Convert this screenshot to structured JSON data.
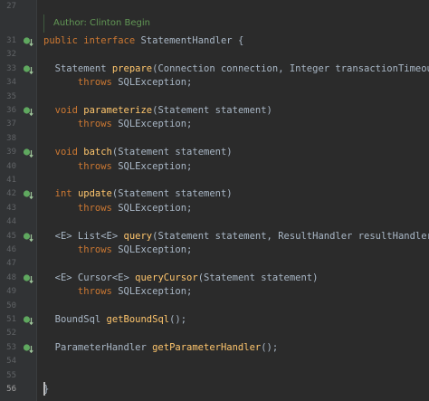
{
  "editor": {
    "javadoc": {
      "author": "Author: Clinton Begin"
    },
    "lines": [
      {
        "num": "27",
        "tokens": []
      },
      {
        "num": "31",
        "icon": true,
        "tokens": [
          {
            "t": "public ",
            "c": "kw"
          },
          {
            "t": "interface ",
            "c": "kw"
          },
          {
            "t": "StatementHandler {",
            "c": "plain"
          }
        ]
      },
      {
        "num": "32",
        "tokens": []
      },
      {
        "num": "33",
        "icon": true,
        "tokens": [
          {
            "t": "  Statement ",
            "c": "plain"
          },
          {
            "t": "prepare",
            "c": "fn"
          },
          {
            "t": "(Connection connection, Integer transactionTimeout)",
            "c": "plain"
          }
        ]
      },
      {
        "num": "34",
        "tokens": [
          {
            "t": "      throws ",
            "c": "kw"
          },
          {
            "t": "SQLException;",
            "c": "plain"
          }
        ]
      },
      {
        "num": "35",
        "tokens": []
      },
      {
        "num": "36",
        "icon": true,
        "tokens": [
          {
            "t": "  void ",
            "c": "kw"
          },
          {
            "t": "parameterize",
            "c": "fn"
          },
          {
            "t": "(Statement statement)",
            "c": "plain"
          }
        ]
      },
      {
        "num": "37",
        "tokens": [
          {
            "t": "      throws ",
            "c": "kw"
          },
          {
            "t": "SQLException;",
            "c": "plain"
          }
        ]
      },
      {
        "num": "38",
        "tokens": []
      },
      {
        "num": "39",
        "icon": true,
        "tokens": [
          {
            "t": "  void ",
            "c": "kw"
          },
          {
            "t": "batch",
            "c": "fn"
          },
          {
            "t": "(Statement statement)",
            "c": "plain"
          }
        ]
      },
      {
        "num": "40",
        "tokens": [
          {
            "t": "      throws ",
            "c": "kw"
          },
          {
            "t": "SQLException;",
            "c": "plain"
          }
        ]
      },
      {
        "num": "41",
        "tokens": []
      },
      {
        "num": "42",
        "icon": true,
        "tokens": [
          {
            "t": "  int ",
            "c": "kw"
          },
          {
            "t": "update",
            "c": "fn"
          },
          {
            "t": "(Statement statement)",
            "c": "plain"
          }
        ]
      },
      {
        "num": "43",
        "tokens": [
          {
            "t": "      throws ",
            "c": "kw"
          },
          {
            "t": "SQLException;",
            "c": "plain"
          }
        ]
      },
      {
        "num": "44",
        "tokens": []
      },
      {
        "num": "45",
        "icon": true,
        "tokens": [
          {
            "t": "  <E> List<E> ",
            "c": "plain"
          },
          {
            "t": "query",
            "c": "fn"
          },
          {
            "t": "(Statement statement, ResultHandler resultHandler)",
            "c": "plain"
          }
        ]
      },
      {
        "num": "46",
        "tokens": [
          {
            "t": "      throws ",
            "c": "kw"
          },
          {
            "t": "SQLException;",
            "c": "plain"
          }
        ]
      },
      {
        "num": "47",
        "tokens": []
      },
      {
        "num": "48",
        "icon": true,
        "tokens": [
          {
            "t": "  <E> Cursor<E> ",
            "c": "plain"
          },
          {
            "t": "queryCursor",
            "c": "fn"
          },
          {
            "t": "(Statement statement)",
            "c": "plain"
          }
        ]
      },
      {
        "num": "49",
        "tokens": [
          {
            "t": "      throws ",
            "c": "kw"
          },
          {
            "t": "SQLException;",
            "c": "plain"
          }
        ]
      },
      {
        "num": "50",
        "tokens": []
      },
      {
        "num": "51",
        "icon": true,
        "tokens": [
          {
            "t": "  BoundSql ",
            "c": "plain"
          },
          {
            "t": "getBoundSql",
            "c": "fn"
          },
          {
            "t": "();",
            "c": "plain"
          }
        ]
      },
      {
        "num": "52",
        "tokens": []
      },
      {
        "num": "53",
        "icon": true,
        "tokens": [
          {
            "t": "  ParameterHandler ",
            "c": "plain"
          },
          {
            "t": "getParameterHandler",
            "c": "fn"
          },
          {
            "t": "();",
            "c": "plain"
          }
        ]
      },
      {
        "num": "54",
        "tokens": []
      },
      {
        "num": "55",
        "tokens": []
      },
      {
        "num": "56",
        "current": true,
        "tokens": [
          {
            "t": "}",
            "c": "plain"
          }
        ]
      }
    ],
    "colors": {
      "background": "#2b2b2b",
      "gutter": "#313335",
      "keyword": "#cc7832",
      "method": "#ffc66d",
      "text": "#a9b7c6",
      "doc": "#629755",
      "implemented_icon": "#5fa85f"
    },
    "icon_name": "implemented-method-icon"
  }
}
